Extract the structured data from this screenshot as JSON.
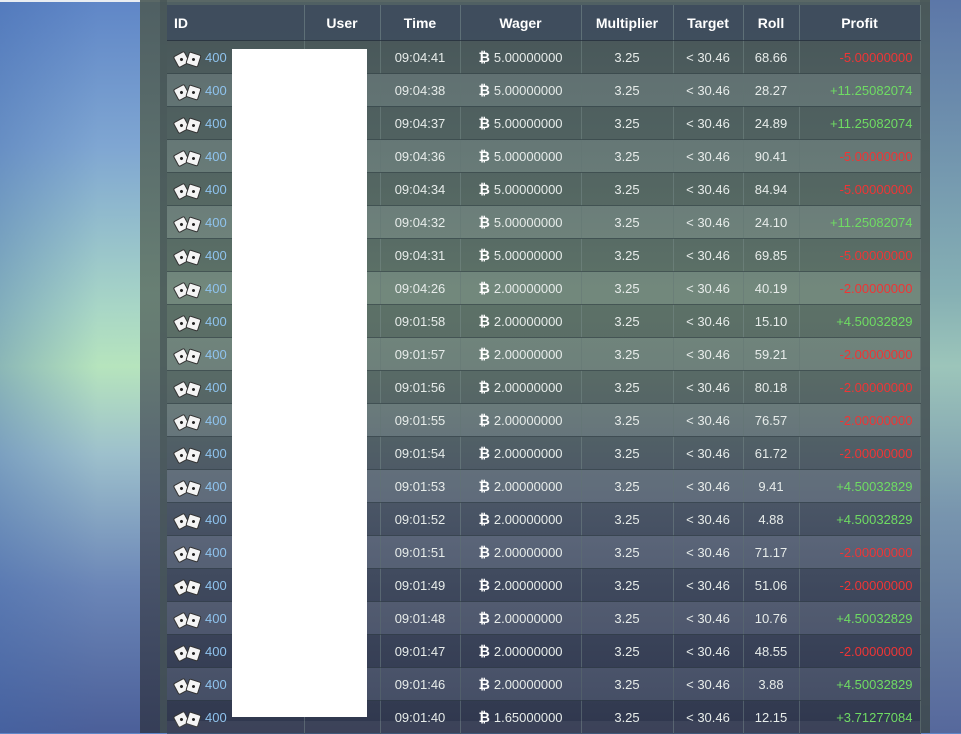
{
  "columns": {
    "id": "ID",
    "user": "User",
    "time": "Time",
    "wager": "Wager",
    "multiplier": "Multiplier",
    "target": "Target",
    "roll": "Roll",
    "profit": "Profit"
  },
  "currency_symbol": "₿",
  "colors": {
    "positive": "#6fdc63",
    "negative": "#ef3535",
    "id_link": "#8fc3ee"
  },
  "rows": [
    {
      "id": "400",
      "time": "09:04:41",
      "wager": "5.00000000",
      "multiplier": "3.25",
      "target": "< 30.46",
      "roll": "68.66",
      "profit": "-5.00000000",
      "win": false
    },
    {
      "id": "400",
      "time": "09:04:38",
      "wager": "5.00000000",
      "multiplier": "3.25",
      "target": "< 30.46",
      "roll": "28.27",
      "profit": "+11.25082074",
      "win": true
    },
    {
      "id": "400",
      "time": "09:04:37",
      "wager": "5.00000000",
      "multiplier": "3.25",
      "target": "< 30.46",
      "roll": "24.89",
      "profit": "+11.25082074",
      "win": true
    },
    {
      "id": "400",
      "time": "09:04:36",
      "wager": "5.00000000",
      "multiplier": "3.25",
      "target": "< 30.46",
      "roll": "90.41",
      "profit": "-5.00000000",
      "win": false
    },
    {
      "id": "400",
      "time": "09:04:34",
      "wager": "5.00000000",
      "multiplier": "3.25",
      "target": "< 30.46",
      "roll": "84.94",
      "profit": "-5.00000000",
      "win": false
    },
    {
      "id": "400",
      "time": "09:04:32",
      "wager": "5.00000000",
      "multiplier": "3.25",
      "target": "< 30.46",
      "roll": "24.10",
      "profit": "+11.25082074",
      "win": true
    },
    {
      "id": "400",
      "time": "09:04:31",
      "wager": "5.00000000",
      "multiplier": "3.25",
      "target": "< 30.46",
      "roll": "69.85",
      "profit": "-5.00000000",
      "win": false
    },
    {
      "id": "400",
      "time": "09:04:26",
      "wager": "2.00000000",
      "multiplier": "3.25",
      "target": "< 30.46",
      "roll": "40.19",
      "profit": "-2.00000000",
      "win": false
    },
    {
      "id": "400",
      "time": "09:01:58",
      "wager": "2.00000000",
      "multiplier": "3.25",
      "target": "< 30.46",
      "roll": "15.10",
      "profit": "+4.50032829",
      "win": true
    },
    {
      "id": "400",
      "time": "09:01:57",
      "wager": "2.00000000",
      "multiplier": "3.25",
      "target": "< 30.46",
      "roll": "59.21",
      "profit": "-2.00000000",
      "win": false
    },
    {
      "id": "400",
      "time": "09:01:56",
      "wager": "2.00000000",
      "multiplier": "3.25",
      "target": "< 30.46",
      "roll": "80.18",
      "profit": "-2.00000000",
      "win": false
    },
    {
      "id": "400",
      "time": "09:01:55",
      "wager": "2.00000000",
      "multiplier": "3.25",
      "target": "< 30.46",
      "roll": "76.57",
      "profit": "-2.00000000",
      "win": false
    },
    {
      "id": "400",
      "time": "09:01:54",
      "wager": "2.00000000",
      "multiplier": "3.25",
      "target": "< 30.46",
      "roll": "61.72",
      "profit": "-2.00000000",
      "win": false
    },
    {
      "id": "400",
      "time": "09:01:53",
      "wager": "2.00000000",
      "multiplier": "3.25",
      "target": "< 30.46",
      "roll": "9.41",
      "profit": "+4.50032829",
      "win": true
    },
    {
      "id": "400",
      "time": "09:01:52",
      "wager": "2.00000000",
      "multiplier": "3.25",
      "target": "< 30.46",
      "roll": "4.88",
      "profit": "+4.50032829",
      "win": true
    },
    {
      "id": "400",
      "time": "09:01:51",
      "wager": "2.00000000",
      "multiplier": "3.25",
      "target": "< 30.46",
      "roll": "71.17",
      "profit": "-2.00000000",
      "win": false
    },
    {
      "id": "400",
      "time": "09:01:49",
      "wager": "2.00000000",
      "multiplier": "3.25",
      "target": "< 30.46",
      "roll": "51.06",
      "profit": "-2.00000000",
      "win": false
    },
    {
      "id": "400",
      "time": "09:01:48",
      "wager": "2.00000000",
      "multiplier": "3.25",
      "target": "< 30.46",
      "roll": "10.76",
      "profit": "+4.50032829",
      "win": true
    },
    {
      "id": "400",
      "time": "09:01:47",
      "wager": "2.00000000",
      "multiplier": "3.25",
      "target": "< 30.46",
      "roll": "48.55",
      "profit": "-2.00000000",
      "win": false
    },
    {
      "id": "400",
      "time": "09:01:46",
      "wager": "2.00000000",
      "multiplier": "3.25",
      "target": "< 30.46",
      "roll": "3.88",
      "profit": "+4.50032829",
      "win": true
    },
    {
      "id": "400",
      "time": "09:01:40",
      "wager": "1.65000000",
      "multiplier": "3.25",
      "target": "< 30.46",
      "roll": "12.15",
      "profit": "+3.71277084",
      "win": true
    }
  ]
}
